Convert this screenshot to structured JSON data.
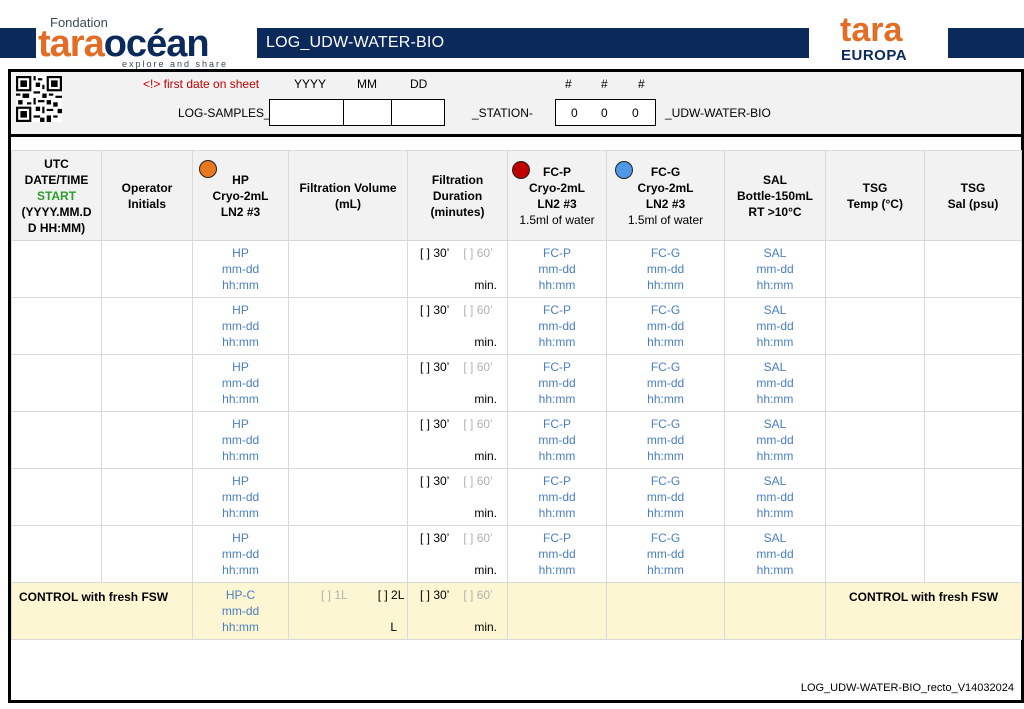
{
  "header": {
    "logo_left": {
      "line1": "Fondation",
      "word_a": "tara",
      "word_b": "océan",
      "tagline": "explore and share"
    },
    "title": "LOG_UDW-WATER-BIO",
    "logo_right": {
      "word": "tara",
      "sub": "EUROPA"
    }
  },
  "info": {
    "first_date": "<!> first date on sheet",
    "yyyy": "YYYY",
    "mm": "MM",
    "dd": "DD",
    "hash1": "#",
    "hash2": "#",
    "hash3": "#",
    "log_samples": "LOG-SAMPLES_",
    "station": "_STATION-",
    "station_digits": [
      "0",
      "0",
      "0"
    ],
    "udw": "_UDW-WATER-BIO"
  },
  "columns": {
    "utc": [
      "UTC",
      "DATE/TIME",
      "START",
      "(YYYY.MM.D",
      "D   HH:MM)"
    ],
    "operator": [
      "Operator",
      "Initials"
    ],
    "hp": [
      "HP",
      "Cryo-2mL",
      "LN2 #3"
    ],
    "filtration_volume": [
      "Filtration Volume",
      "(mL)"
    ],
    "filtration_duration": [
      "Filtration",
      "Duration",
      "(minutes)"
    ],
    "fcp": [
      "FC-P",
      "Cryo-2mL",
      "LN2 #3",
      "1.5ml of water"
    ],
    "fcg": [
      "FC-G",
      "Cryo-2mL",
      "LN2 #3",
      "1.5ml of water"
    ],
    "sal": [
      "SAL",
      "Bottle-150mL",
      "RT >10°C"
    ],
    "tsg_temp": [
      "TSG",
      "Temp (°C)"
    ],
    "tsg_sal": [
      "TSG",
      "Sal (psu)"
    ]
  },
  "colors": {
    "hp_circle": "#e87722",
    "fcp_circle": "#c00000",
    "fcg_circle": "#4f97e8",
    "start": "#2e9e2e",
    "navy": "#0b2a5b"
  },
  "rows": [
    {
      "hp": [
        "HP",
        "mm-dd",
        "hh:mm"
      ],
      "dur30": "[ ] 30’",
      "dur60": "[ ] 60’",
      "min": "min.",
      "fcp": [
        "FC-P",
        "mm-dd",
        "hh:mm"
      ],
      "fcg": [
        "FC-G",
        "mm-dd",
        "hh:mm"
      ],
      "sal": [
        "SAL",
        "mm-dd",
        "hh:mm"
      ]
    },
    {
      "hp": [
        "HP",
        "mm-dd",
        "hh:mm"
      ],
      "dur30": "[ ] 30’",
      "dur60": "[ ] 60’",
      "min": "min.",
      "fcp": [
        "FC-P",
        "mm-dd",
        "hh:mm"
      ],
      "fcg": [
        "FC-G",
        "mm-dd",
        "hh:mm"
      ],
      "sal": [
        "SAL",
        "mm-dd",
        "hh:mm"
      ]
    },
    {
      "hp": [
        "HP",
        "mm-dd",
        "hh:mm"
      ],
      "dur30": "[ ] 30’",
      "dur60": "[ ] 60’",
      "min": "min.",
      "fcp": [
        "FC-P",
        "mm-dd",
        "hh:mm"
      ],
      "fcg": [
        "FC-G",
        "mm-dd",
        "hh:mm"
      ],
      "sal": [
        "SAL",
        "mm-dd",
        "hh:mm"
      ]
    },
    {
      "hp": [
        "HP",
        "mm-dd",
        "hh:mm"
      ],
      "dur30": "[ ] 30’",
      "dur60": "[ ] 60’",
      "min": "min.",
      "fcp": [
        "FC-P",
        "mm-dd",
        "hh:mm"
      ],
      "fcg": [
        "FC-G",
        "mm-dd",
        "hh:mm"
      ],
      "sal": [
        "SAL",
        "mm-dd",
        "hh:mm"
      ]
    },
    {
      "hp": [
        "HP",
        "mm-dd",
        "hh:mm"
      ],
      "dur30": "[ ] 30’",
      "dur60": "[ ] 60’",
      "min": "min.",
      "fcp": [
        "FC-P",
        "mm-dd",
        "hh:mm"
      ],
      "fcg": [
        "FC-G",
        "mm-dd",
        "hh:mm"
      ],
      "sal": [
        "SAL",
        "mm-dd",
        "hh:mm"
      ]
    },
    {
      "hp": [
        "HP",
        "mm-dd",
        "hh:mm"
      ],
      "dur30": "[ ] 30’",
      "dur60": "[ ] 60’",
      "min": "min.",
      "fcp": [
        "FC-P",
        "mm-dd",
        "hh:mm"
      ],
      "fcg": [
        "FC-G",
        "mm-dd",
        "hh:mm"
      ],
      "sal": [
        "SAL",
        "mm-dd",
        "hh:mm"
      ]
    }
  ],
  "control": {
    "label_left": "CONTROL with fresh FSW",
    "hp": [
      "HP-C",
      "mm-dd",
      "hh:mm"
    ],
    "vol1": "[ ] 1L",
    "vol2": "[ ] 2L",
    "vol_unit": "L",
    "dur30": "[ ] 30’",
    "dur60": "[ ] 60’",
    "min": "min.",
    "label_right": "CONTROL with fresh FSW"
  },
  "footer": "LOG_UDW-WATER-BIO_recto_V14032024"
}
